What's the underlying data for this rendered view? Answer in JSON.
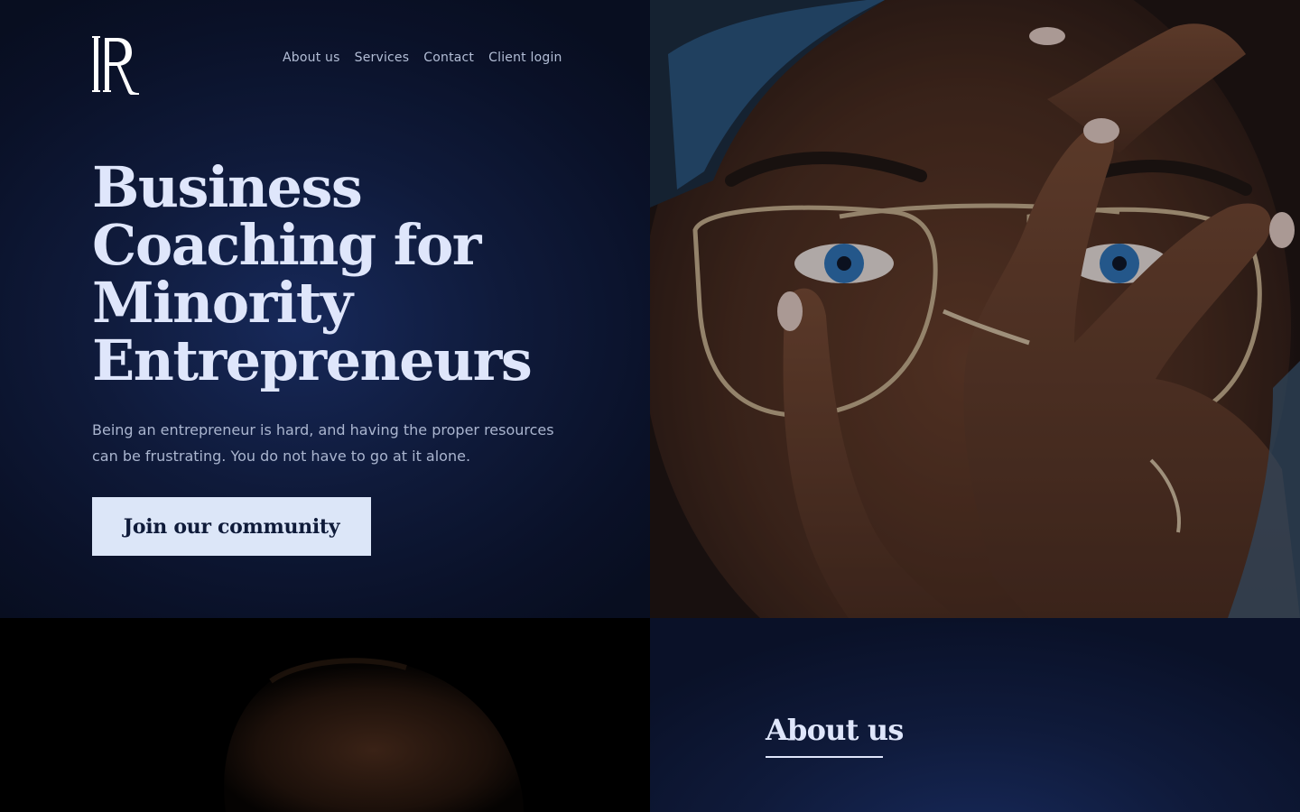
{
  "brand": {
    "logo_text": "R"
  },
  "nav": {
    "items": [
      {
        "label": "About us"
      },
      {
        "label": "Services"
      },
      {
        "label": "Contact"
      },
      {
        "label": "Client login"
      }
    ]
  },
  "hero": {
    "title_lines": [
      "Business",
      "Coaching for",
      "Minority",
      "Entrepreneurs"
    ],
    "description": "Being an entrepreneur is hard, and having the proper resources can be frustrating. You do not have to go at it alone.",
    "cta_label": "Join our community"
  },
  "about": {
    "heading": "About us"
  },
  "colors": {
    "background_navy": "#0a1128",
    "heading_text": "#dfe6fb",
    "body_text": "#aab5cf",
    "button_bg": "#dce6f8",
    "button_text": "#0f1b3a"
  }
}
